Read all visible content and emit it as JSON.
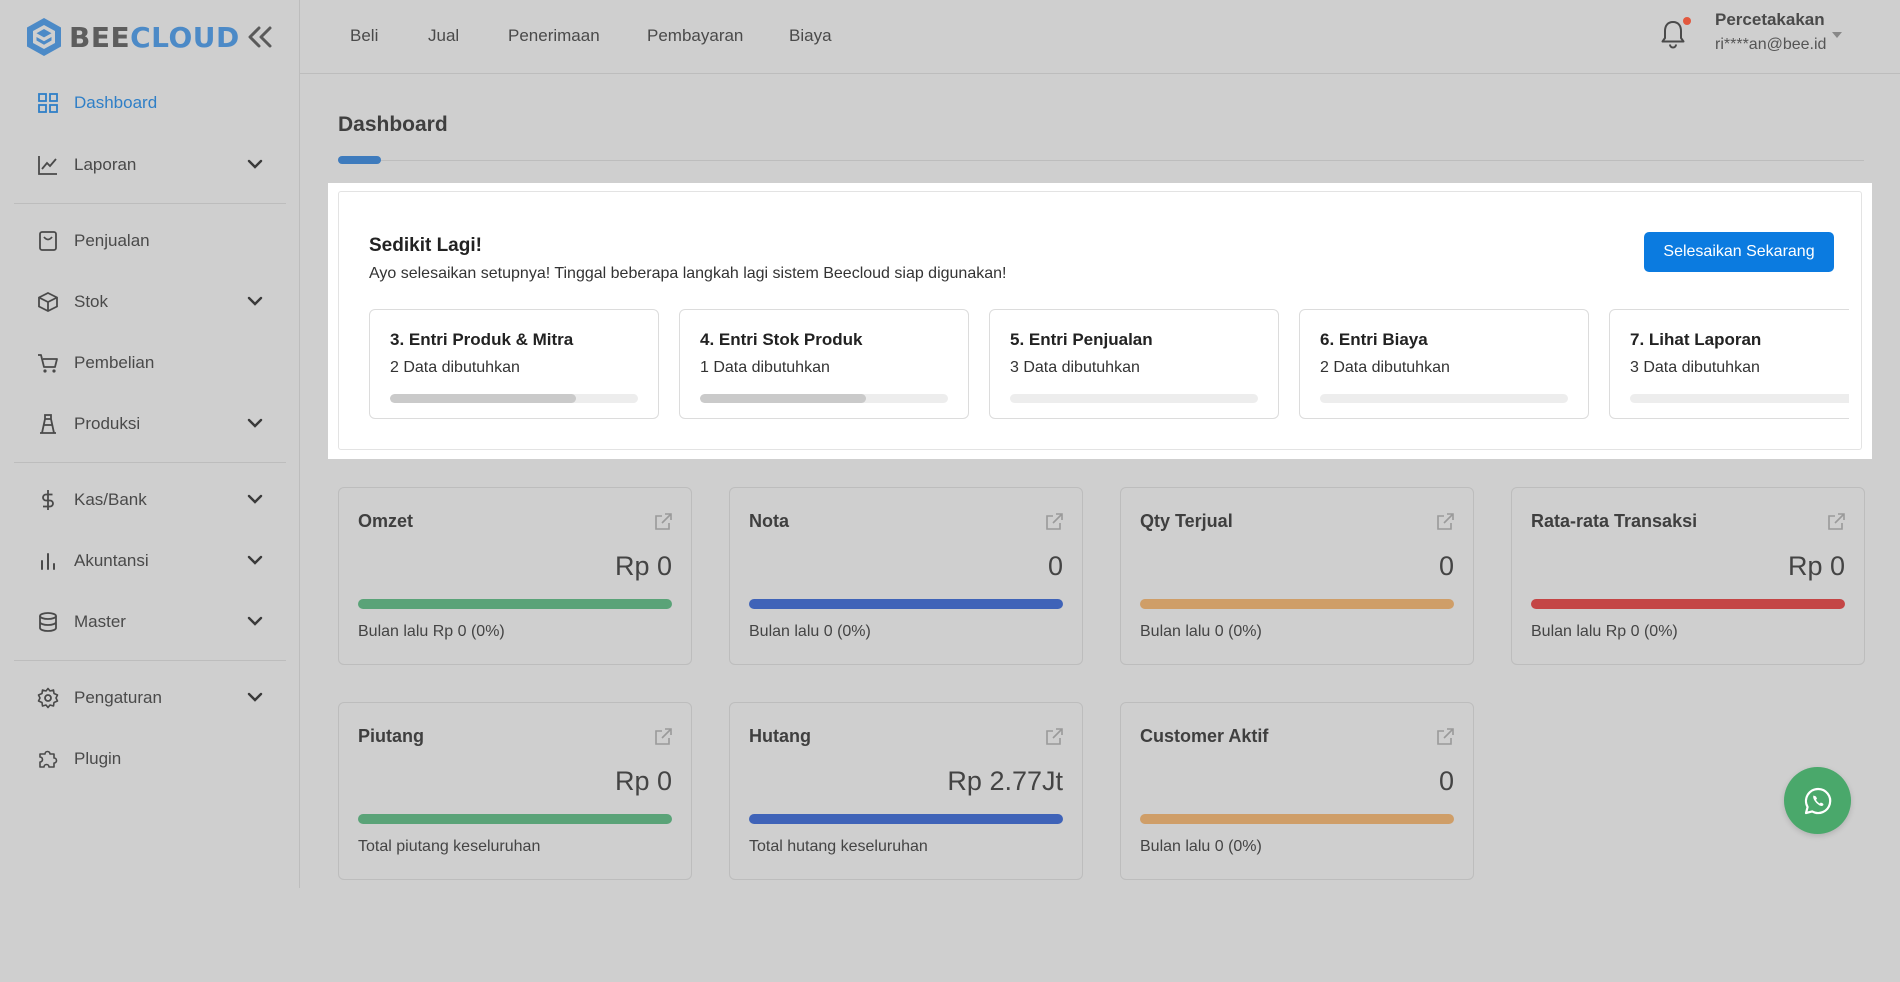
{
  "brand": {
    "part1": "BEE",
    "part2": "CLOUD"
  },
  "sidebar": {
    "items": [
      {
        "label": "Dashboard",
        "icon": "grid-icon",
        "active": true,
        "expandable": false
      },
      {
        "label": "Laporan",
        "icon": "chart-line-icon",
        "active": false,
        "expandable": true
      },
      {
        "label": "Penjualan",
        "icon": "receipt-icon",
        "active": false,
        "expandable": false
      },
      {
        "label": "Stok",
        "icon": "box-icon",
        "active": false,
        "expandable": true
      },
      {
        "label": "Pembelian",
        "icon": "cart-icon",
        "active": false,
        "expandable": false
      },
      {
        "label": "Produksi",
        "icon": "factory-icon",
        "active": false,
        "expandable": true
      },
      {
        "label": "Kas/Bank",
        "icon": "dollar-icon",
        "active": false,
        "expandable": true
      },
      {
        "label": "Akuntansi",
        "icon": "bar-chart-icon",
        "active": false,
        "expandable": true
      },
      {
        "label": "Master",
        "icon": "database-icon",
        "active": false,
        "expandable": true
      },
      {
        "label": "Pengaturan",
        "icon": "gear-icon",
        "active": false,
        "expandable": true
      },
      {
        "label": "Plugin",
        "icon": "puzzle-icon",
        "active": false,
        "expandable": false
      }
    ]
  },
  "topnav": {
    "items": [
      "Beli",
      "Jual",
      "Penerimaan",
      "Pembayaran",
      "Biaya"
    ]
  },
  "user": {
    "name": "Percetakakan",
    "email": "ri****an@bee.id",
    "has_notification": true
  },
  "page": {
    "title": "Dashboard"
  },
  "setup": {
    "title": "Sedikit Lagi!",
    "subtitle": "Ayo selesaikan setupnya! Tinggal beberapa langkah lagi sistem Beecloud siap digunakan!",
    "button": "Selesaikan Sekarang",
    "steps": [
      {
        "title": "3. Entri Produk & Mitra",
        "subtitle": "2 Data dibutuhkan",
        "progress": 0.75
      },
      {
        "title": "4. Entri Stok Produk",
        "subtitle": "1 Data dibutuhkan",
        "progress": 0.67
      },
      {
        "title": "5. Entri Penjualan",
        "subtitle": "3 Data dibutuhkan",
        "progress": 0
      },
      {
        "title": "6. Entri Biaya",
        "subtitle": "2 Data dibutuhkan",
        "progress": 0
      },
      {
        "title": "7. Lihat Laporan",
        "subtitle": "3 Data dibutuhkan",
        "progress": 0
      }
    ]
  },
  "stats": [
    {
      "title": "Omzet",
      "value": "Rp 0",
      "footer": "Bulan lalu Rp 0 (0%)",
      "color": "#5aa378"
    },
    {
      "title": "Nota",
      "value": "0",
      "footer": "Bulan lalu 0 (0%)",
      "color": "#3f63b8"
    },
    {
      "title": "Qty Terjual",
      "value": "0",
      "footer": "Bulan lalu 0 (0%)",
      "color": "#cf9e68"
    },
    {
      "title": "Rata-rata Transaksi",
      "value": "Rp 0",
      "footer": "Bulan lalu Rp 0 (0%)",
      "color": "#c44545"
    },
    {
      "title": "Piutang",
      "value": "Rp 0",
      "footer": "Total piutang keseluruhan",
      "color": "#5aa378"
    },
    {
      "title": "Hutang",
      "value": "Rp 2.77Jt",
      "footer": "Total hutang keseluruhan",
      "color": "#3f63b8"
    },
    {
      "title": "Customer Aktif",
      "value": "0",
      "footer": "Bulan lalu 0 (0%)",
      "color": "#cf9e68"
    }
  ]
}
